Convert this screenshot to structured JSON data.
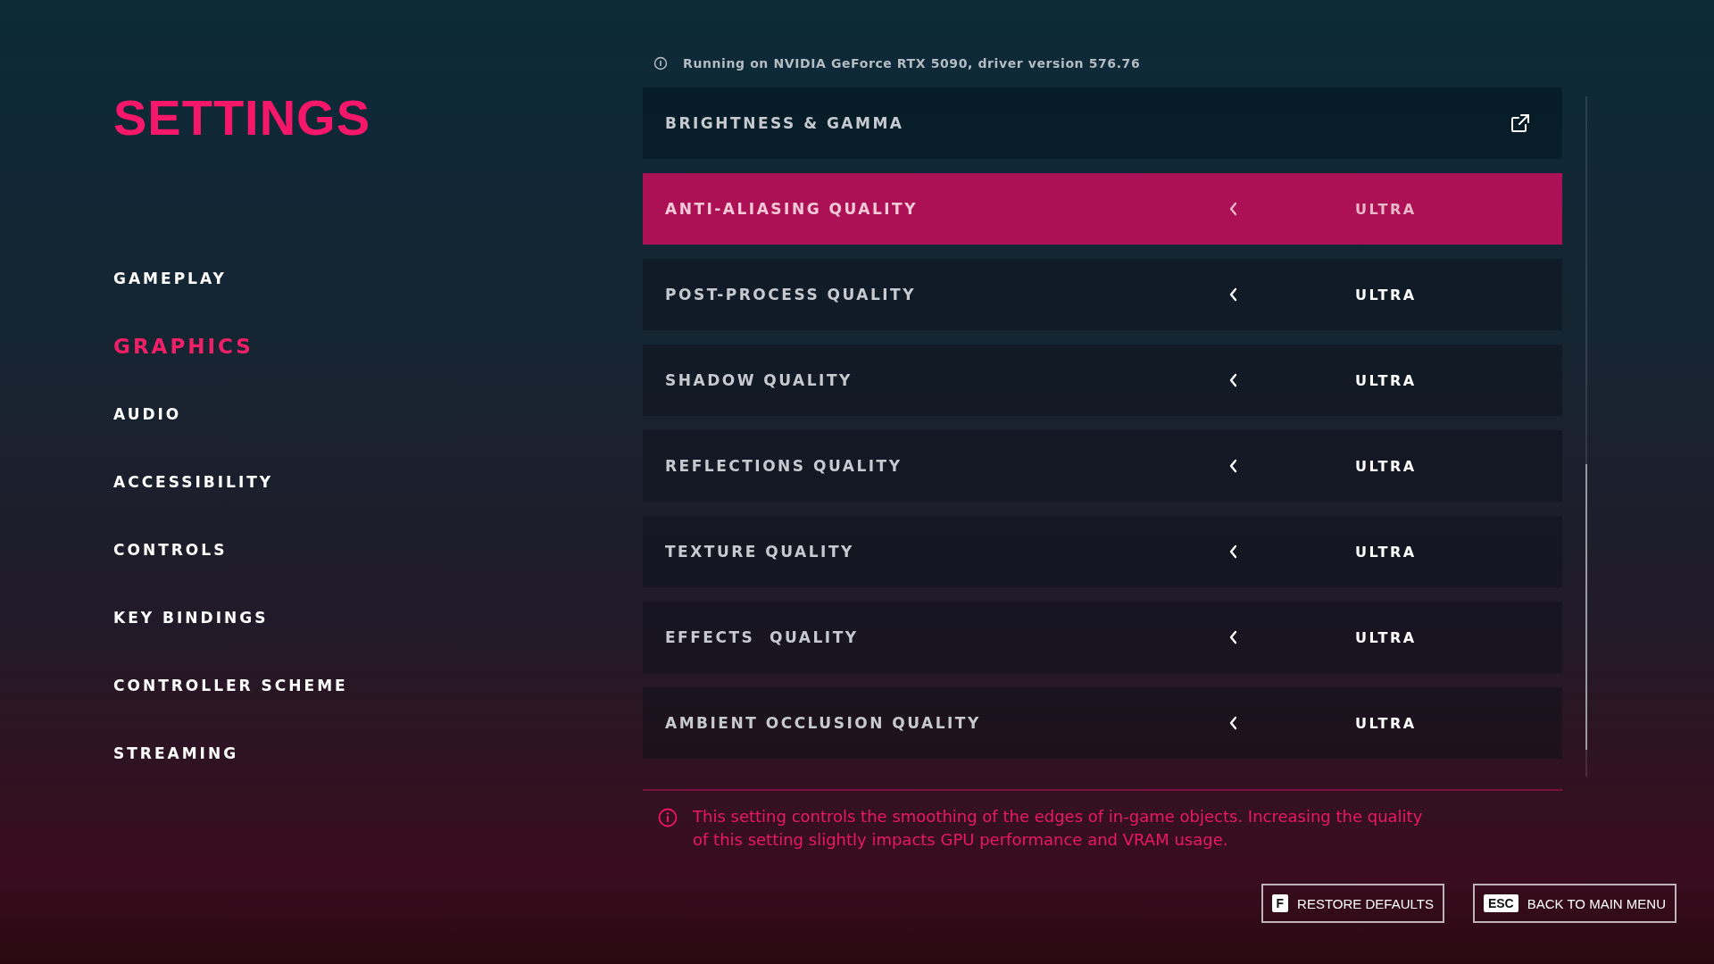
{
  "title": "SETTINGS",
  "nav": [
    {
      "label": "GAMEPLAY",
      "selected": false
    },
    {
      "label": "GRAPHICS",
      "selected": true
    },
    {
      "label": "AUDIO",
      "selected": false
    },
    {
      "label": "ACCESSIBILITY",
      "selected": false
    },
    {
      "label": "CONTROLS",
      "selected": false
    },
    {
      "label": "KEY BINDINGS",
      "selected": false
    },
    {
      "label": "CONTROLLER SCHEME",
      "selected": false
    },
    {
      "label": "STREAMING",
      "selected": false
    }
  ],
  "gpu_info": "Running on NVIDIA GeForce RTX 5090, driver version 576.76",
  "settings": [
    {
      "kind": "link",
      "label": "BRIGHTNESS & GAMMA",
      "selected": false
    },
    {
      "kind": "option",
      "label": "ANTI-ALIASING QUALITY",
      "value": "ULTRA",
      "selected": true
    },
    {
      "kind": "option",
      "label": "POST-PROCESS QUALITY",
      "value": "ULTRA",
      "selected": false
    },
    {
      "kind": "option",
      "label": "SHADOW QUALITY",
      "value": "ULTRA",
      "selected": false
    },
    {
      "kind": "option",
      "label": "REFLECTIONS QUALITY",
      "value": "ULTRA",
      "selected": false
    },
    {
      "kind": "option",
      "label": "TEXTURE QUALITY",
      "value": "ULTRA",
      "selected": false
    },
    {
      "kind": "option",
      "label": "EFFECTS  QUALITY",
      "value": "ULTRA",
      "selected": false
    },
    {
      "kind": "option",
      "label": "AMBIENT OCCLUSION QUALITY",
      "value": "ULTRA",
      "selected": false
    }
  ],
  "description": "This setting controls the smoothing of the edges of in-game objects. Increasing the quality of this setting slightly impacts GPU performance and VRAM usage.",
  "buttons": [
    {
      "key": "F",
      "label": "RESTORE DEFAULTS"
    },
    {
      "key": "ESC",
      "label": "BACK TO MAIN MENU"
    }
  ]
}
